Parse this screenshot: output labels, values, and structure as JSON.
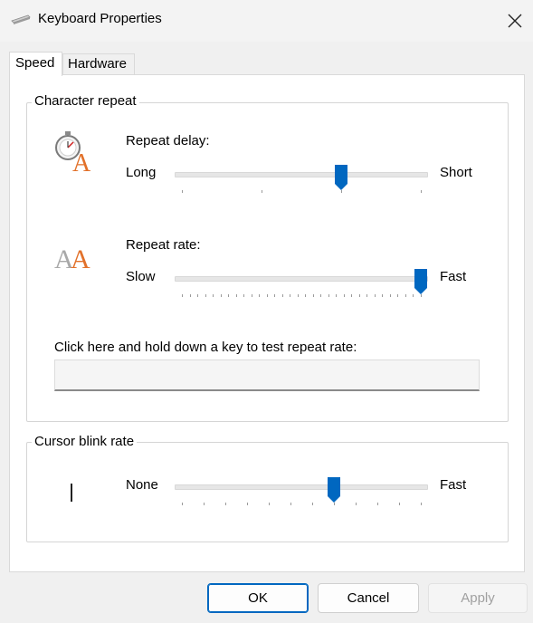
{
  "window": {
    "title": "Keyboard Properties",
    "icon": "keyboard-icon",
    "close_icon": "close-icon"
  },
  "tabs": [
    {
      "label": "Speed",
      "selected": true
    },
    {
      "label": "Hardware",
      "selected": false
    }
  ],
  "character_repeat": {
    "group_label": "Character repeat",
    "repeat_delay": {
      "icon": "stopwatch-letter-a-icon",
      "label": "Repeat delay:",
      "min_label": "Long",
      "max_label": "Short",
      "value": 2,
      "max": 3
    },
    "repeat_rate": {
      "icon": "double-letter-a-icon",
      "label": "Repeat rate:",
      "min_label": "Slow",
      "max_label": "Fast",
      "value": 31,
      "max": 31
    },
    "test_label": "Click here and hold down a key to test repeat rate:",
    "test_value": ""
  },
  "cursor_blink": {
    "group_label": "Cursor blink rate",
    "min_label": "None",
    "max_label": "Fast",
    "value": 7,
    "max": 11
  },
  "buttons": {
    "ok": "OK",
    "cancel": "Cancel",
    "apply": "Apply",
    "apply_enabled": false
  },
  "colors": {
    "accent": "#0067c0",
    "stopwatch_letter": "#e2712a",
    "letter_gray": "#a8a8a8"
  }
}
